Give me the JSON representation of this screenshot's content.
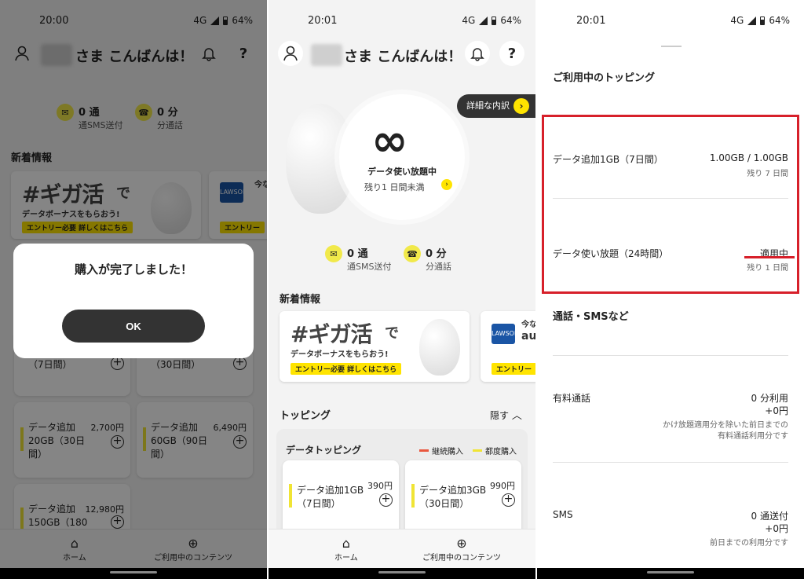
{
  "status": {
    "time1": "20:00",
    "time2": "20:01",
    "time3": "20:01",
    "network": "4G",
    "battery": "64%"
  },
  "header": {
    "greeting": "さま こんばんは！",
    "help_icon": "?"
  },
  "stats": {
    "sms_value": "0 通",
    "sms_label": "通SMS送付",
    "call_value": "0 分",
    "call_label": "分通話"
  },
  "news": {
    "title": "新着情報",
    "banner_big": "#ギガ活",
    "banner_de": "で",
    "banner_sub": "データボーナスをもらおう!",
    "banner_tag": "エントリー必要 詳しくはこちら",
    "banner2_tag": "エントリー",
    "banner2_text": "今な",
    "banner2_au": "au",
    "banner2_small": "LAWSON"
  },
  "dialog": {
    "message": "購入が完了しました！",
    "ok": "OK"
  },
  "panel1_cards": [
    {
      "name": "（7日間）",
      "price": ""
    },
    {
      "name": "（30日間）",
      "price": ""
    },
    {
      "name": "データ追加\n20GB（30日\n間）",
      "price": "2,700円"
    },
    {
      "name": "データ追加\n60GB（90日\n間）",
      "price": "6,490円"
    },
    {
      "name": "データ追加\n150GB（180",
      "price": "12,980円"
    }
  ],
  "infinity": {
    "symbol": "∞",
    "title": "データ使い放題中",
    "remain": "残り1 日間未満",
    "detail_button": "詳細な内訳"
  },
  "topping": {
    "title": "トッピング",
    "hide": "隠す",
    "data_topping": "データトッピング",
    "legend_continuous": "継続購入",
    "legend_each": "都度購入",
    "legend_continuous_color": "#e9573e",
    "legend_each_color": "#f0e434",
    "cards": [
      {
        "name": "データ追加1GB\n（7日間）",
        "price": "390円"
      },
      {
        "name": "データ追加3GB\n（30日間）",
        "price": "990円"
      }
    ]
  },
  "nav": {
    "home": "ホーム",
    "contents": "ご利用中のコンテンツ"
  },
  "detail": {
    "section_title": "ご利用中のトッピング",
    "items": [
      {
        "label": "データ追加1GB（7日間）",
        "value": "1.00GB / 1.00GB",
        "sub": "残り 7 日間"
      },
      {
        "label": "データ使い放題（24時間）",
        "value": "適用中",
        "sub": "残り 1 日間"
      }
    ],
    "call_section": "通話・SMSなど",
    "paid_call_label": "有料通話",
    "paid_call_value": "0 分利用",
    "paid_call_price": "+0円",
    "paid_call_note1": "かけ放題適用分を除いた前日までの",
    "paid_call_note2": "有料通話利用分です",
    "sms_label": "SMS",
    "sms_value": "0 通送付",
    "sms_price": "+0円",
    "sms_note": "前日までの利用分です",
    "highlight_color": "#d7202a"
  }
}
